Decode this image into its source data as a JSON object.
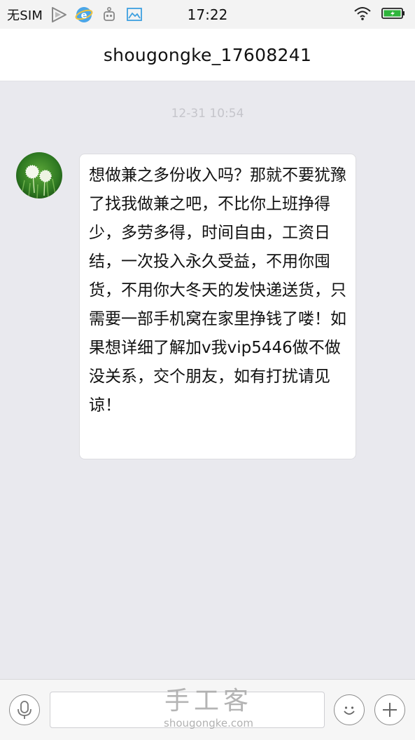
{
  "status_bar": {
    "carrier": "无SIM",
    "time": "17:22",
    "icons": [
      "play-icon",
      "browser-icon",
      "robot-icon",
      "gallery-icon",
      "wifi-icon",
      "battery-icon"
    ]
  },
  "header": {
    "title": "shougongke_17608241"
  },
  "chat": {
    "timestamp": "12-31 10:54",
    "message": {
      "text": "想做兼之多份收入吗？那就不要犹豫了找我做兼之吧，不比你上班挣得少，多劳多得，时间自由，工资日结，一次投入永久受益，不用你囤货，不用你大冬天的发快递送货，只需要一部手机窝在家里挣钱了喽！如果想详细了解加v我vip5446做不做没关系，交个朋友，如有打扰请见谅！"
    }
  },
  "input_bar": {
    "placeholder": "",
    "icons": [
      "microphone-icon",
      "smiley-icon",
      "plus-icon"
    ]
  },
  "watermark": {
    "main": "手工客",
    "sub": "shougongke.com"
  },
  "colors": {
    "chat_background": "#e9e9ee",
    "bubble": "#ffffff",
    "header": "#ffffff",
    "battery": "#2fb53c"
  }
}
